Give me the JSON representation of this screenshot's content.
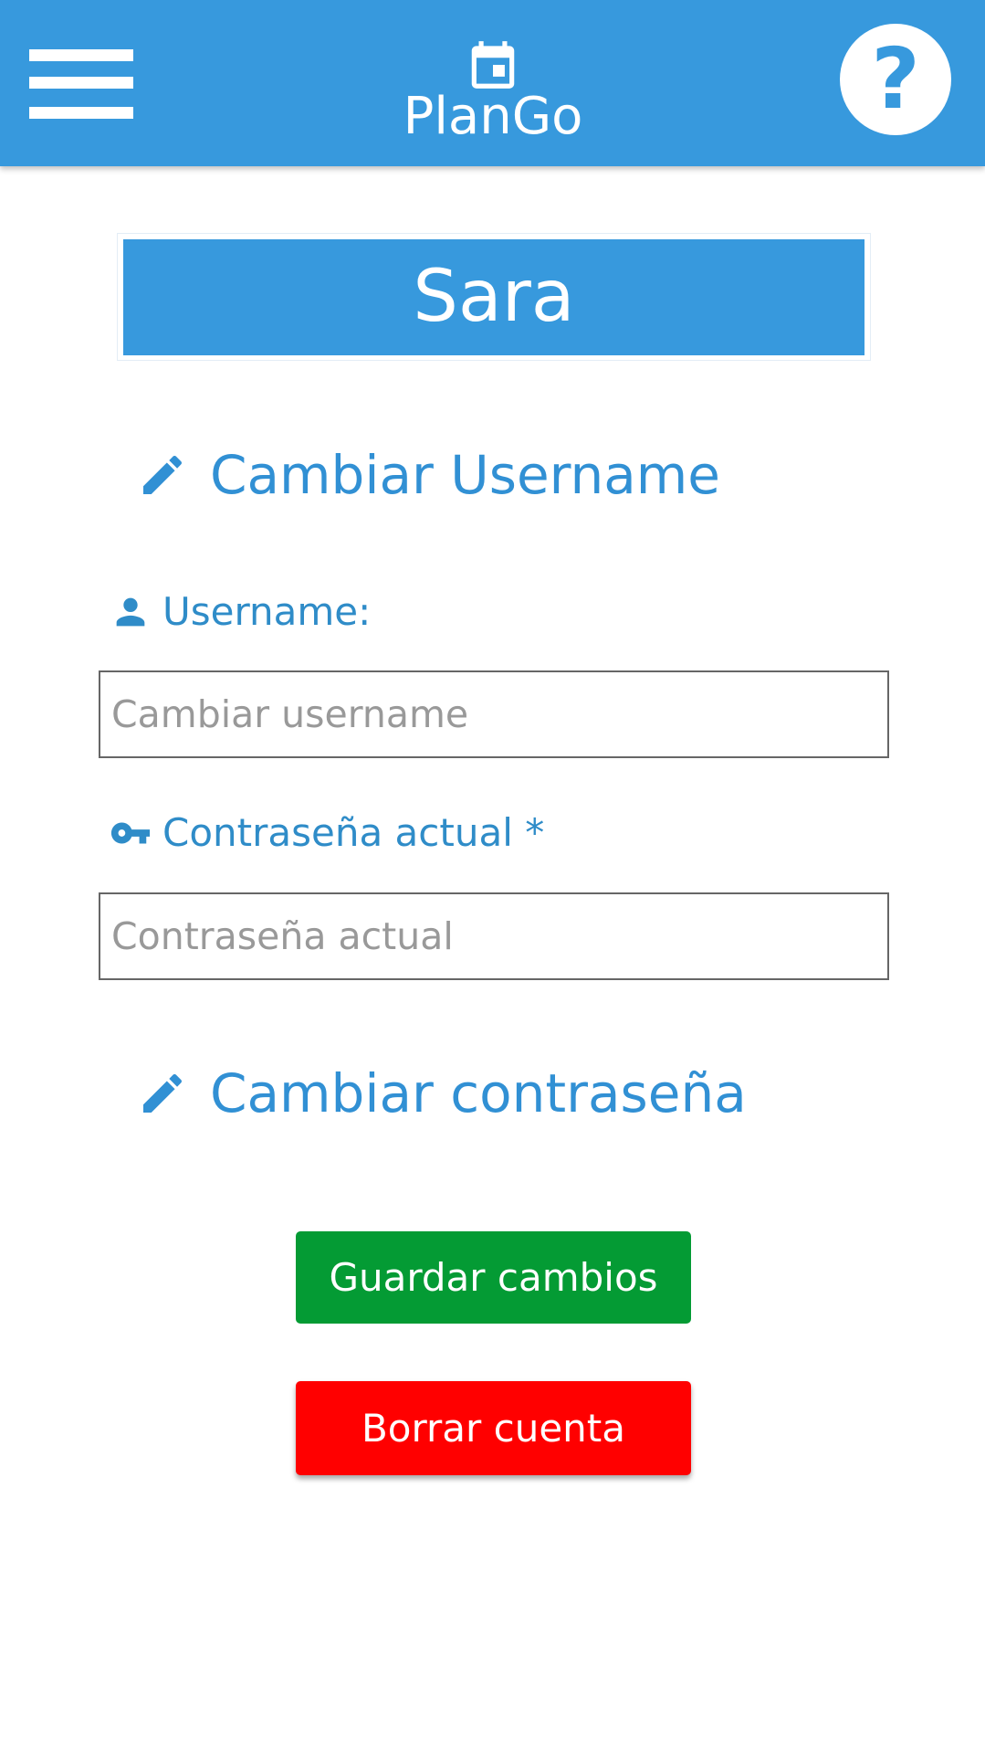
{
  "header": {
    "app_title": "PlanGo",
    "menu_icon": "hamburger-menu-icon",
    "logo_icon": "calendar-icon",
    "help_label": "?",
    "background_color": "#3799dd"
  },
  "profile": {
    "username": "Sara"
  },
  "sections": {
    "change_username": {
      "label": "Cambiar Username",
      "icon": "pencil-icon"
    },
    "change_password": {
      "label": "Cambiar contraseña",
      "icon": "pencil-icon"
    }
  },
  "form": {
    "username_label": "Username:",
    "username_icon": "user-icon",
    "username_placeholder": "Cambiar username",
    "username_value": "",
    "password_label": "Contraseña actual *",
    "password_icon": "key-icon",
    "password_placeholder": "Contraseña actual",
    "password_value": ""
  },
  "actions": {
    "save_label": "Guardar cambios",
    "save_color": "#049b34",
    "delete_label": "Borrar cuenta",
    "delete_color": "#ff0000"
  }
}
